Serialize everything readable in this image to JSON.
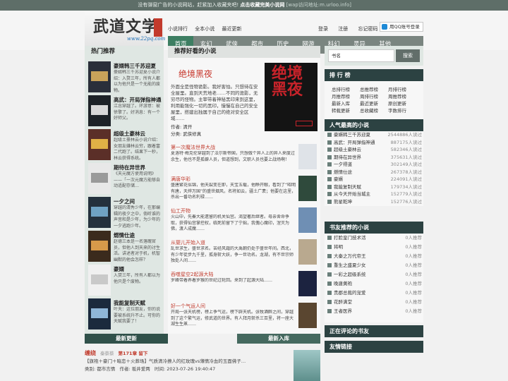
{
  "topbar": {
    "notice": "没有弹窗广告的小说网站，赶紧加入收藏夹吧!",
    "cta": "点击收藏完美小说网",
    "wap": "[wap访问地址:m.urloo.info]"
  },
  "site": {
    "logo_text": "武道文学",
    "logo_url": "www.22pq.com"
  },
  "toplinks": [
    "小说排行",
    "全本小说",
    "最近更新"
  ],
  "userlinks": [
    "登录",
    "注册",
    "忘记密码"
  ],
  "qq_button": "用QQ账号登录",
  "nav": [
    "首页",
    "玄幻",
    "武侠",
    "都市",
    "历史",
    "网游",
    "科幻",
    "灵异",
    "其他"
  ],
  "hot": {
    "title": "热门推荐",
    "items": [
      {
        "title": "豪婿韩三千苏迎夏",
        "desc": "豪婿韩三千苏迎夏小说介绍：入赘三年，所有人都以为他只是一个无能的废物。"
      },
      {
        "title": "高武：开局弹指神通",
        "desc": "江念穿越了。环游意：被徐擎了。好消息：有一个好师父。"
      },
      {
        "title": "超级土豪林云",
        "desc": "超级土豪林云小说介绍：女朋友嫌林云穷，跟着富二代跑了。结果下一秒，林云获得系统。"
      },
      {
        "title": "期待在异世界",
        "desc": "《天元魔方使用说明》——「一次元魔方能够自动适配存储…"
      },
      {
        "title": "一夕之间",
        "desc": "穿越的清秀少年，在那编辑的夜夕之中，倘听谁的声音和是少年，为少年的一夕逃跑少年。"
      },
      {
        "title": "燃情仕途",
        "desc": "赵德三本是一名落魄官员，但他人到天来的讨生活。讲述者对于机，机智幽默的他会怎样？"
      },
      {
        "title": "豪婿",
        "desc": "入赘三年，所有人都以为他只是个废物。"
      },
      {
        "title": "我能复制天赋",
        "desc": "叶天：这位朋友，你的说要被系统升不止。可你的天赋我要了！"
      }
    ]
  },
  "recommend": {
    "title": "推荐好看的小说",
    "featured": {
      "title": "绝境黑夜",
      "desc": "外面全是怪物诡影。我好害怕。只想待在安全屋里。直到天荒地老……不同的诡影，无穷尽的怪物。主宰带着神秘黑印来到这里，利用能强化一切的黑印，慢慢在自己的安全屋里，搭建出独属于自己的绝对安全区域……",
      "author_label": "作者:",
      "author": "清开",
      "category_label": "分类:",
      "category": "武侠修真",
      "cover_text": "绝境黑夜"
    },
    "items": [
      {
        "title": "第一次魔法世界大战",
        "desc": "夏洛特·梅克伦穿越到了法尔斯帝国，只想做个异人上的异人来度过余生，他也不是孤僻人员，但道想到，文职人员也要上战场啊！"
      },
      {
        "title": "满唐华彩",
        "desc": "盛唐繁花似锦，他天裂变在即，天宝五载，他睁开眼，看到了“昭明有唐，天烨万国”的盛世烟风，名将如云，疆土广袤；他要在这里，杀出一番功名利禄……"
      },
      {
        "title": "仙工开物",
        "desc": "火山中，先秦大能遗留的机关仙宫。渴望著后继者。母亲舍命争取，获得仙宫掌控权，临死前留下了宁拙，我傀心魔印，涅灭为佛，渡人成魔……"
      },
      {
        "title": "从婴儿开始入道",
        "desc": "乱世求生，盛世求名。苦经风霜的大禹朝仍处于盛世年间。西北，有少年徒步九千里，孤身斩大妖，争一世功名。龙湖，有不世宗师独处人间……"
      },
      {
        "title": "吞噬星空2起源大陆",
        "desc": "罗峰带着养着罗猴的世纪过轮回。来到了起源大陆……"
      },
      {
        "title": "好一个气运人间",
        "desc": "开局一张天机榜，榜上争气运，榜下辟天机。张牧酒醉之间，穿越到了这个繁气运，修武道的世界。有人拜月斩杀三百里，将一座大湖生生蒸……"
      }
    ]
  },
  "search": {
    "placeholder": "书名",
    "button": "搜索"
  },
  "rank": {
    "title": "排 行 榜",
    "rows": [
      [
        "总排行榜",
        "总推荐榜",
        "月排行榜"
      ],
      [
        "月推荐榜",
        "周排行榜",
        "周推荐榜"
      ],
      [
        "最新入库",
        "最近更新",
        "原创更新"
      ],
      [
        "转载更新",
        "总收藏榜",
        "字数排行"
      ]
    ]
  },
  "popular": {
    "title": "人气最高的小说",
    "items": [
      {
        "name": "豪婿韩三千苏迎夏",
        "val": "2544886人读过"
      },
      {
        "name": "高武：开局弹指神通",
        "val": "887175人读过"
      },
      {
        "name": "超级土豪林云",
        "val": "582346人读过"
      },
      {
        "name": "期待在异世界",
        "val": "375631人读过"
      },
      {
        "name": "一夕得道",
        "val": "302149人读过"
      },
      {
        "name": "燃情仕途",
        "val": "267378人读过"
      },
      {
        "name": "豪婿",
        "val": "224091人读过"
      },
      {
        "name": "我能复制天赋",
        "val": "179734人读过"
      },
      {
        "name": "从今天开始当城主",
        "val": "152779人读过"
      },
      {
        "name": "熊星乾坤",
        "val": "152776人读过"
      }
    ]
  },
  "recs": {
    "title": "书友推荐的小说",
    "items": [
      {
        "name": "打脸皇门技术活",
        "val": "0人推荐"
      },
      {
        "name": "将明",
        "val": "0人推荐"
      },
      {
        "name": "大秦之万代帝王",
        "val": "0人推荐"
      },
      {
        "name": "重生之盛夏少女",
        "val": "0人推荐"
      },
      {
        "name": "一彩之超级系统",
        "val": "0人推荐"
      },
      {
        "name": "晚唐黄袍",
        "val": "0人推荐"
      },
      {
        "name": "贵郡总裁的宠爱",
        "val": "0人推荐"
      },
      {
        "name": "花醉满堂",
        "val": "0人推荐"
      },
      {
        "name": "王者医界",
        "val": "0人推荐"
      }
    ]
  },
  "reviews": {
    "title": "正在评论的书友"
  },
  "links": {
    "title": "友情链接"
  },
  "bottom": {
    "tab1": "最新更新",
    "tab2": "最新入库",
    "update": {
      "title": "缠绕",
      "author": "秦蔡蔡",
      "chapter": "第171章 留下",
      "desc": "【旗袍＋豪门＋暗恋＋火葬场】气质清冷撩人的红玫瑰vs薄情冷血的玉面佛子…",
      "cat_label": "类别:",
      "cat": "都市言情",
      "author_label": "作者:",
      "author2": "坂井爱两",
      "time_label": "时间:",
      "time": "2023-07-26 19:40:47"
    }
  }
}
